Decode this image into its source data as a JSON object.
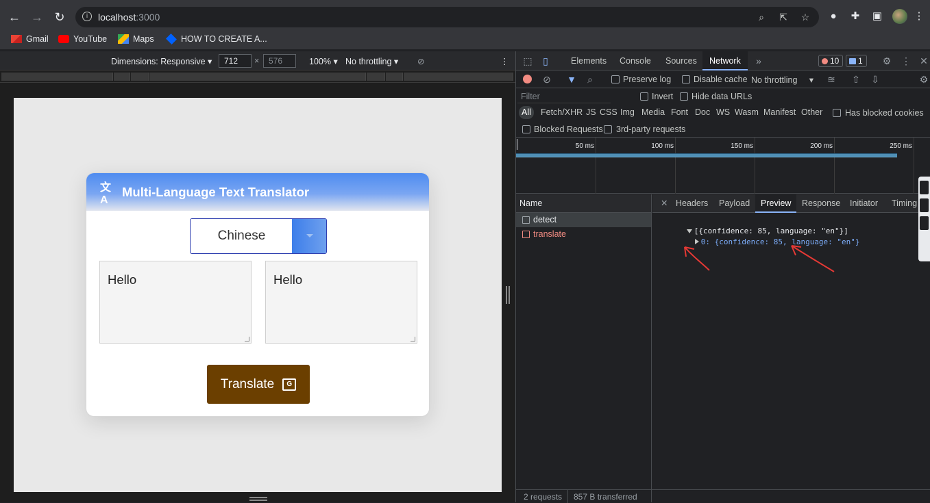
{
  "browser": {
    "url_host": "localhost",
    "url_port": ":3000",
    "bookmarks": [
      "Gmail",
      "YouTube",
      "Maps",
      "HOW TO CREATE A..."
    ]
  },
  "device_toolbar": {
    "dimensions_label": "Dimensions: Responsive",
    "width": "712",
    "height": "576",
    "zoom": "100%",
    "throttling": "No throttling"
  },
  "app": {
    "title": "Multi-Language Text Translator",
    "selected_language": "Chinese",
    "input_text": "Hello",
    "output_text": "Hello",
    "translate_label": "Translate",
    "colors": {
      "header_start": "#4f8cf0",
      "button": "#6b3f00"
    }
  },
  "devtools": {
    "tabs": [
      "Elements",
      "Console",
      "Sources",
      "Network"
    ],
    "active_tab": "Network",
    "error_count": "10",
    "message_count": "1",
    "toolbar": {
      "preserve_log": "Preserve log",
      "disable_cache": "Disable cache",
      "throttling": "No throttling"
    },
    "filter_placeholder": "Filter",
    "invert": "Invert",
    "hide_data_urls": "Hide data URLs",
    "types": [
      "All",
      "Fetch/XHR",
      "JS",
      "CSS",
      "Img",
      "Media",
      "Font",
      "Doc",
      "WS",
      "Wasm",
      "Manifest",
      "Other"
    ],
    "has_blocked_cookies": "Has blocked cookies",
    "blocked_requests": "Blocked Requests",
    "third_party": "3rd-party requests",
    "timeline_ticks": [
      "50 ms",
      "100 ms",
      "150 ms",
      "200 ms",
      "250 ms"
    ],
    "name_header": "Name",
    "requests": [
      {
        "name": "detect"
      },
      {
        "name": "translate"
      }
    ],
    "detail_tabs": [
      "Headers",
      "Payload",
      "Preview",
      "Response",
      "Initiator",
      "Timing"
    ],
    "preview_lines": [
      "[{confidence: 85, language: \"en\"}]",
      "0: {confidence: 85, language: \"en\"}"
    ],
    "status": {
      "requests": "2 requests",
      "transferred": "857 B transferred"
    }
  }
}
